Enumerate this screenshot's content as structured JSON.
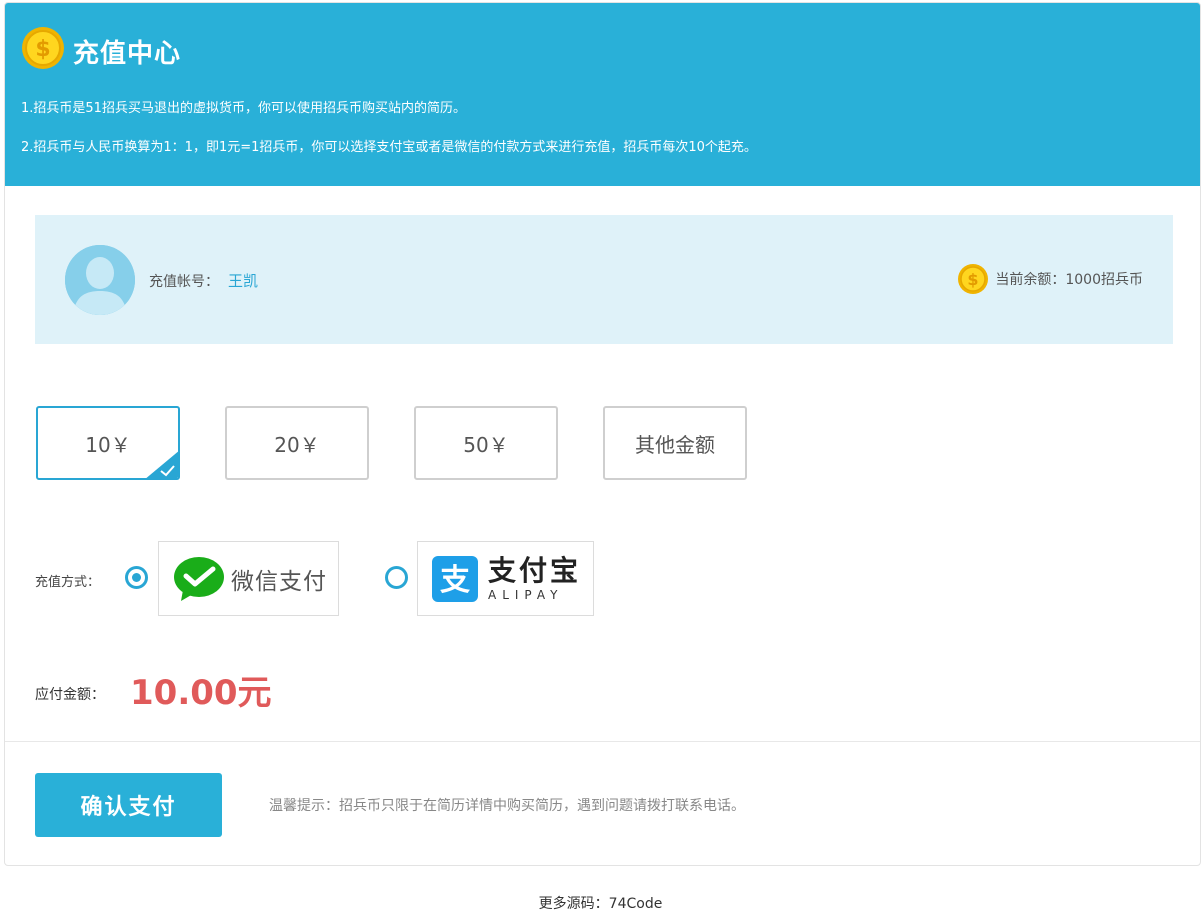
{
  "header": {
    "title": "充值中心",
    "note1": "1.招兵币是51招兵买马退出的虚拟货币，你可以使用招兵币购买站内的简历。",
    "note2": "2.招兵币与人民币换算为1：1，即1元=1招兵币，你可以选择支付宝或者是微信的付款方式来进行充值，招兵币每次10个起充。"
  },
  "account": {
    "label": "充值帐号：",
    "name": "王凯",
    "balance_text": "当前余额：1000招兵币"
  },
  "amounts": [
    {
      "label": "10￥",
      "selected": true
    },
    {
      "label": "20￥",
      "selected": false
    },
    {
      "label": "50￥",
      "selected": false
    },
    {
      "label": "其他金额",
      "selected": false
    }
  ],
  "payment": {
    "label": "充值方式：",
    "wechat_label": "微信支付",
    "alipay_cn": "支付宝",
    "alipay_en": "ALIPAY",
    "selected": "wechat"
  },
  "due": {
    "label": "应付金额：",
    "value": "10.00元"
  },
  "confirm_label": "确认支付",
  "tip": "温馨提示：招兵币只限于在简历详情中购买简历，遇到问题请拨打联系电话。",
  "footer": "更多源码：74Code",
  "colors": {
    "primary": "#29b0d8",
    "account_bg": "#dff2f9",
    "price": "#e05a5a",
    "coin": "#f5c000"
  }
}
